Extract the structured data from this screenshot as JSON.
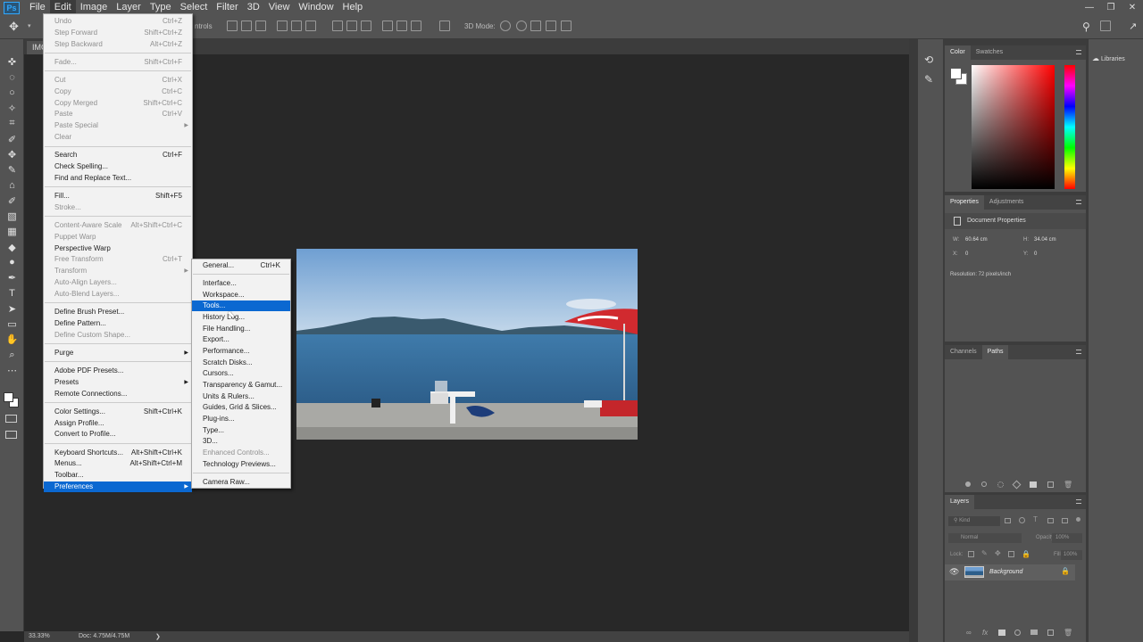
{
  "app": {
    "logo": "Ps"
  },
  "menubar": [
    "File",
    "Edit",
    "Image",
    "Layer",
    "Type",
    "Select",
    "Filter",
    "3D",
    "View",
    "Window",
    "Help"
  ],
  "active_menu": "Edit",
  "options_bar": {
    "controls_label": "ntrols",
    "mode_label": "3D Mode:"
  },
  "doc_tab": {
    "label": "IMG"
  },
  "status": {
    "zoom": "33.33%",
    "doc": "Doc: 4.75M/4.75M"
  },
  "edit_menu": [
    {
      "label": "Undo",
      "sc": "Ctrl+Z",
      "dis": true
    },
    {
      "label": "Step Forward",
      "sc": "Shift+Ctrl+Z",
      "dis": true
    },
    {
      "label": "Step Backward",
      "sc": "Alt+Ctrl+Z",
      "dis": true
    },
    {
      "sep": true
    },
    {
      "label": "Fade...",
      "sc": "Shift+Ctrl+F",
      "dis": true
    },
    {
      "sep": true
    },
    {
      "label": "Cut",
      "sc": "Ctrl+X",
      "dis": true
    },
    {
      "label": "Copy",
      "sc": "Ctrl+C",
      "dis": true
    },
    {
      "label": "Copy Merged",
      "sc": "Shift+Ctrl+C",
      "dis": true
    },
    {
      "label": "Paste",
      "sc": "Ctrl+V",
      "dis": true
    },
    {
      "label": "Paste Special",
      "sc": "",
      "dis": true,
      "sub": true
    },
    {
      "label": "Clear",
      "sc": "",
      "dis": true
    },
    {
      "sep": true
    },
    {
      "label": "Search",
      "sc": "Ctrl+F"
    },
    {
      "label": "Check Spelling...",
      "sc": ""
    },
    {
      "label": "Find and Replace Text...",
      "sc": ""
    },
    {
      "sep": true
    },
    {
      "label": "Fill...",
      "sc": "Shift+F5"
    },
    {
      "label": "Stroke...",
      "sc": "",
      "dis": true
    },
    {
      "sep": true
    },
    {
      "label": "Content-Aware Scale",
      "sc": "Alt+Shift+Ctrl+C",
      "dis": true
    },
    {
      "label": "Puppet Warp",
      "sc": "",
      "dis": true
    },
    {
      "label": "Perspective Warp",
      "sc": ""
    },
    {
      "label": "Free Transform",
      "sc": "Ctrl+T",
      "dis": true
    },
    {
      "label": "Transform",
      "sc": "",
      "dis": true,
      "sub": true
    },
    {
      "label": "Auto-Align Layers...",
      "sc": "",
      "dis": true
    },
    {
      "label": "Auto-Blend Layers...",
      "sc": "",
      "dis": true
    },
    {
      "sep": true
    },
    {
      "label": "Define Brush Preset...",
      "sc": ""
    },
    {
      "label": "Define Pattern...",
      "sc": ""
    },
    {
      "label": "Define Custom Shape...",
      "sc": "",
      "dis": true
    },
    {
      "sep": true
    },
    {
      "label": "Purge",
      "sc": "",
      "sub": true
    },
    {
      "sep": true
    },
    {
      "label": "Adobe PDF Presets...",
      "sc": ""
    },
    {
      "label": "Presets",
      "sc": "",
      "sub": true
    },
    {
      "label": "Remote Connections...",
      "sc": ""
    },
    {
      "sep": true
    },
    {
      "label": "Color Settings...",
      "sc": "Shift+Ctrl+K"
    },
    {
      "label": "Assign Profile...",
      "sc": ""
    },
    {
      "label": "Convert to Profile...",
      "sc": ""
    },
    {
      "sep": true
    },
    {
      "label": "Keyboard Shortcuts...",
      "sc": "Alt+Shift+Ctrl+K"
    },
    {
      "label": "Menus...",
      "sc": "Alt+Shift+Ctrl+M"
    },
    {
      "label": "Toolbar...",
      "sc": ""
    },
    {
      "label": "Preferences",
      "sc": "",
      "sub": true,
      "sel": true
    }
  ],
  "prefs_menu": [
    {
      "label": "General...",
      "sc": "Ctrl+K"
    },
    {
      "sep": true
    },
    {
      "label": "Interface...",
      "sc": ""
    },
    {
      "label": "Workspace...",
      "sc": ""
    },
    {
      "label": "Tools...",
      "sc": "",
      "sel": true
    },
    {
      "label": "History Log...",
      "sc": ""
    },
    {
      "label": "File Handling...",
      "sc": ""
    },
    {
      "label": "Export...",
      "sc": ""
    },
    {
      "label": "Performance...",
      "sc": ""
    },
    {
      "label": "Scratch Disks...",
      "sc": ""
    },
    {
      "label": "Cursors...",
      "sc": ""
    },
    {
      "label": "Transparency & Gamut...",
      "sc": ""
    },
    {
      "label": "Units & Rulers...",
      "sc": ""
    },
    {
      "label": "Guides, Grid & Slices...",
      "sc": ""
    },
    {
      "label": "Plug-ins...",
      "sc": ""
    },
    {
      "label": "Type...",
      "sc": ""
    },
    {
      "label": "3D...",
      "sc": ""
    },
    {
      "label": "Enhanced Controls...",
      "sc": "",
      "dis": true
    },
    {
      "label": "Technology Previews...",
      "sc": ""
    },
    {
      "sep": true
    },
    {
      "label": "Camera Raw...",
      "sc": ""
    }
  ],
  "color_panel": {
    "tabs": [
      "Color",
      "Swatches"
    ]
  },
  "properties_panel": {
    "tabs": [
      "Properties",
      "Adjustments"
    ],
    "title": "Document Properties",
    "w_label": "W:",
    "w_value": "60.64 cm",
    "h_label": "H:",
    "h_value": "34.04 cm",
    "x_label": "X:",
    "x_value": "0",
    "y_label": "Y:",
    "y_value": "0",
    "resolution": "Resolution: 72 pixels/inch"
  },
  "paths_panel": {
    "tabs": [
      "Channels",
      "Paths"
    ]
  },
  "layers_panel": {
    "tab": "Layers",
    "kind_placeholder": "Kind",
    "blend_mode": "Normal",
    "opacity_label": "Opacity:",
    "opacity_value": "100%",
    "lock_label": "Lock:",
    "fill_label": "Fill:",
    "fill_value": "100%",
    "layer_name": "Background"
  },
  "libraries": {
    "label": "Libraries"
  }
}
